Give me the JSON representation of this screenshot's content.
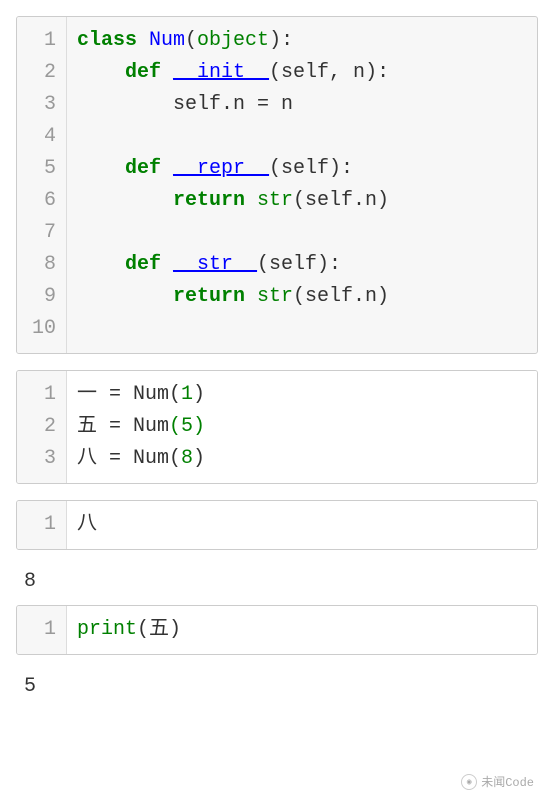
{
  "cells": [
    {
      "type": "code",
      "background": "gray",
      "lines": [
        {
          "n": 1,
          "tokens": [
            {
              "t": "class ",
              "c": "kw"
            },
            {
              "t": "Num",
              "c": "cls"
            },
            {
              "t": "(",
              "c": ""
            },
            {
              "t": "object",
              "c": "builtin"
            },
            {
              "t": "):",
              "c": ""
            }
          ]
        },
        {
          "n": 2,
          "tokens": [
            {
              "t": "    ",
              "c": ""
            },
            {
              "t": "def ",
              "c": "kw"
            },
            {
              "t": "__init__",
              "c": "dunder"
            },
            {
              "t": "(self, n):",
              "c": ""
            }
          ]
        },
        {
          "n": 3,
          "tokens": [
            {
              "t": "        self.n = n",
              "c": ""
            }
          ]
        },
        {
          "n": 4,
          "tokens": [
            {
              "t": "",
              "c": ""
            }
          ]
        },
        {
          "n": 5,
          "tokens": [
            {
              "t": "    ",
              "c": ""
            },
            {
              "t": "def ",
              "c": "kw"
            },
            {
              "t": "__repr__",
              "c": "dunder"
            },
            {
              "t": "(self):",
              "c": ""
            }
          ]
        },
        {
          "n": 6,
          "tokens": [
            {
              "t": "        ",
              "c": ""
            },
            {
              "t": "return ",
              "c": "kw"
            },
            {
              "t": "str",
              "c": "builtin"
            },
            {
              "t": "(self.n)",
              "c": ""
            }
          ]
        },
        {
          "n": 7,
          "tokens": [
            {
              "t": "",
              "c": ""
            }
          ]
        },
        {
          "n": 8,
          "tokens": [
            {
              "t": "    ",
              "c": ""
            },
            {
              "t": "def ",
              "c": "kw"
            },
            {
              "t": "__str__",
              "c": "dunder"
            },
            {
              "t": "(self):",
              "c": ""
            }
          ]
        },
        {
          "n": 9,
          "tokens": [
            {
              "t": "        ",
              "c": ""
            },
            {
              "t": "return ",
              "c": "kw"
            },
            {
              "t": "str",
              "c": "builtin"
            },
            {
              "t": "(self.n)",
              "c": ""
            }
          ]
        },
        {
          "n": 10,
          "tokens": [
            {
              "t": "",
              "c": ""
            }
          ]
        }
      ]
    },
    {
      "type": "code",
      "background": "white",
      "lines": [
        {
          "n": 1,
          "tokens": [
            {
              "t": "一 = Num(",
              "c": ""
            },
            {
              "t": "1",
              "c": "num"
            },
            {
              "t": ")",
              "c": ""
            }
          ]
        },
        {
          "n": 2,
          "tokens": [
            {
              "t": "五 = Num",
              "c": ""
            },
            {
              "t": "(5)",
              "c": "num"
            }
          ]
        },
        {
          "n": 3,
          "tokens": [
            {
              "t": "八 = Num(",
              "c": ""
            },
            {
              "t": "8",
              "c": "num"
            },
            {
              "t": ")",
              "c": ""
            }
          ]
        }
      ]
    },
    {
      "type": "code",
      "background": "white",
      "lines": [
        {
          "n": 1,
          "tokens": [
            {
              "t": "八",
              "c": ""
            }
          ]
        }
      ]
    },
    {
      "type": "output",
      "text": "8"
    },
    {
      "type": "code",
      "background": "white",
      "lines": [
        {
          "n": 1,
          "tokens": [
            {
              "t": "print",
              "c": "builtin"
            },
            {
              "t": "(五)",
              "c": ""
            }
          ]
        }
      ]
    },
    {
      "type": "output",
      "text": "5"
    }
  ],
  "watermark": "未闻Code"
}
